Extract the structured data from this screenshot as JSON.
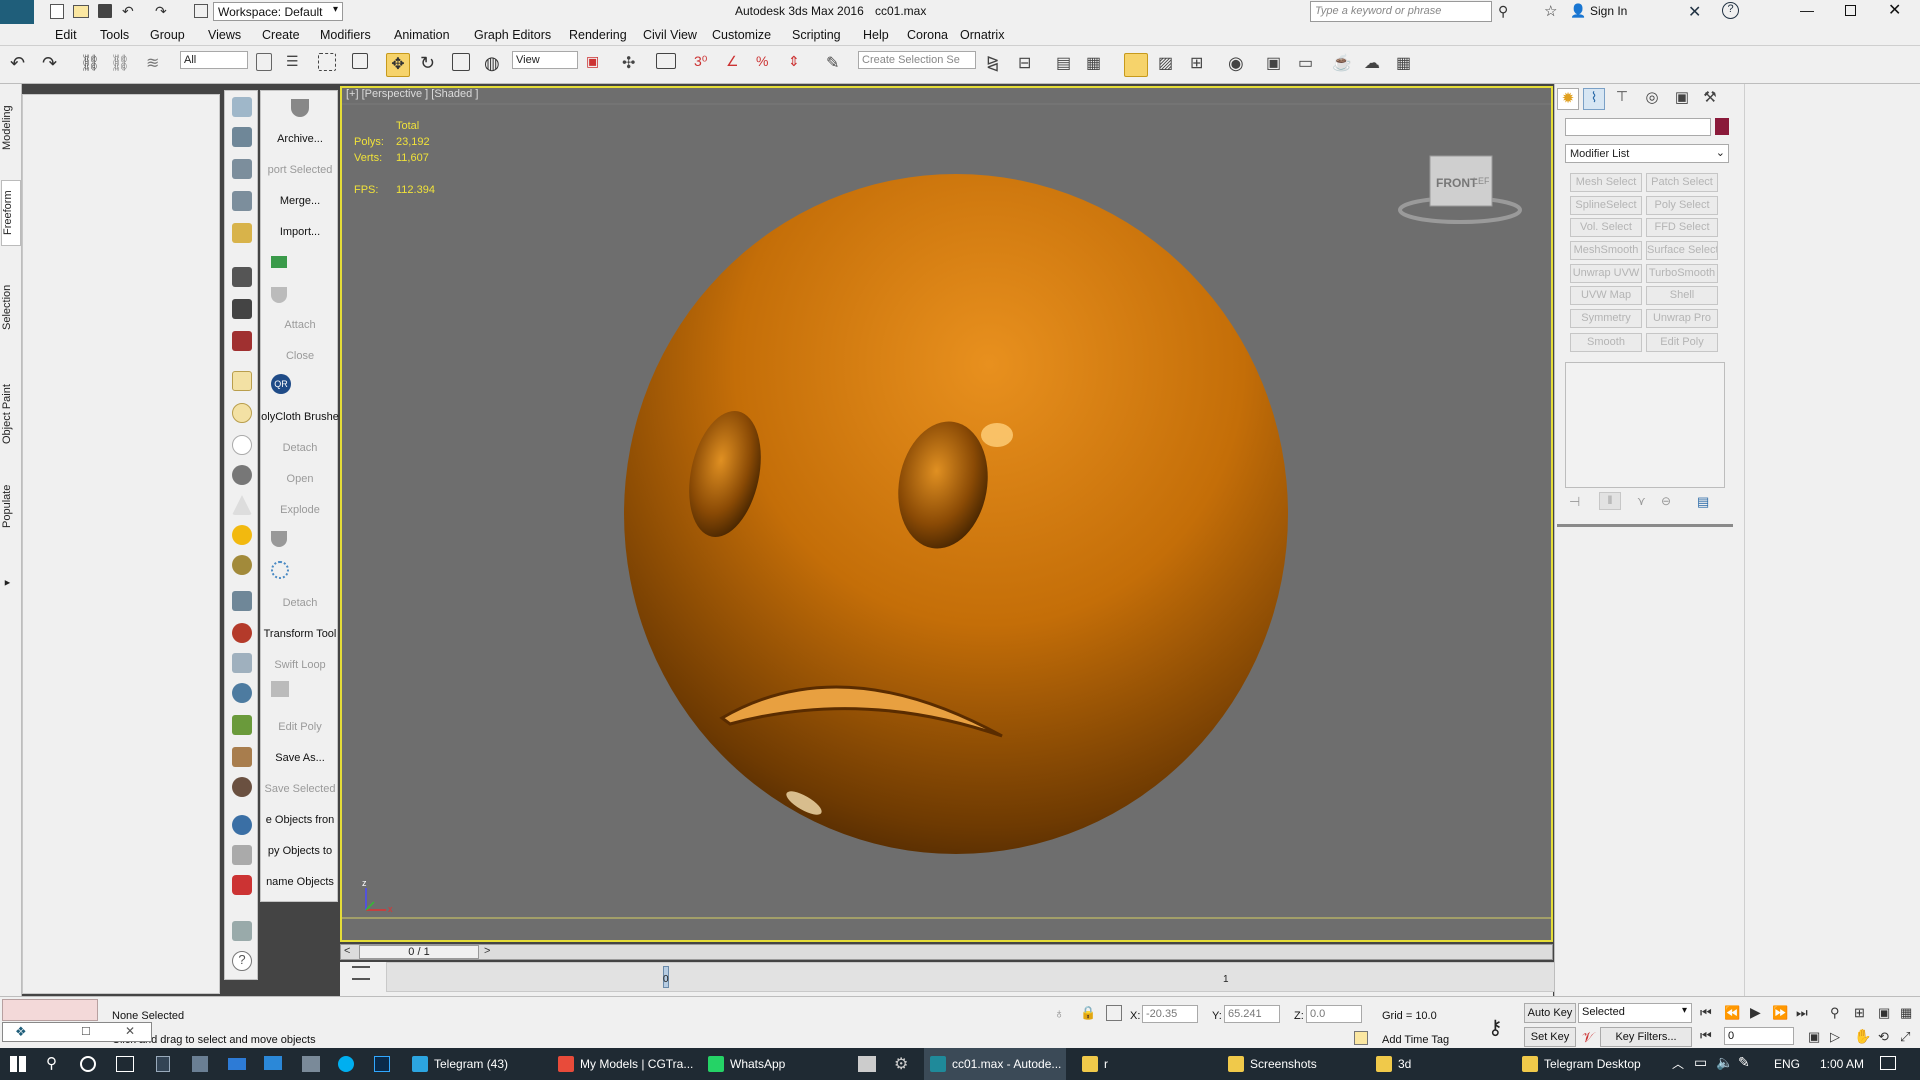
{
  "titlebar": {
    "workspace": "Workspace: Default",
    "app_title": "Autodesk 3ds Max 2016",
    "file": "cc01.max",
    "search_placeholder": "Type a keyword or phrase",
    "signin": "Sign In",
    "logo": "MAX"
  },
  "menu": [
    "Edit",
    "Tools",
    "Group",
    "Views",
    "Create",
    "Modifiers",
    "Animation",
    "Graph Editors",
    "Rendering",
    "Civil View",
    "Customize",
    "Scripting",
    "Help",
    "Corona",
    "Ornatrix"
  ],
  "toolbar": {
    "filter": "All",
    "coord": "View",
    "selection_set": "Create Selection Se"
  },
  "left_tabs": [
    "Modeling",
    "Freeform",
    "Selection",
    "Object Paint",
    "Populate"
  ],
  "tool_labels": [
    {
      "t": "Archive...",
      "d": false
    },
    {
      "t": "port Selected",
      "d": true
    },
    {
      "t": "Merge...",
      "d": false
    },
    {
      "t": "Import...",
      "d": false
    },
    {
      "t": "Attach",
      "d": true
    },
    {
      "t": "Close",
      "d": true
    },
    {
      "t": "olyCloth Brushe",
      "d": false
    },
    {
      "t": "Detach",
      "d": true
    },
    {
      "t": "Open",
      "d": true
    },
    {
      "t": "Explode",
      "d": true
    },
    {
      "t": "Detach",
      "d": true
    },
    {
      "t": "Transform Tool",
      "d": false
    },
    {
      "t": "Swift Loop",
      "d": true
    },
    {
      "t": "Edit Poly",
      "d": true
    },
    {
      "t": "Save As...",
      "d": false
    },
    {
      "t": "Save Selected",
      "d": true
    },
    {
      "t": "e Objects fron",
      "d": false
    },
    {
      "t": "py Objects to",
      "d": false
    },
    {
      "t": "name Objects",
      "d": false
    }
  ],
  "viewport": {
    "header": "[+] [Perspective ] [Shaded ]",
    "total": "Total",
    "polys_label": "Polys:",
    "polys": "23,192",
    "verts_label": "Verts:",
    "verts": "11,607",
    "fps_label": "FPS:",
    "fps": "112.394",
    "viewcube_front": "FRONT",
    "viewcube_side": "LEFT"
  },
  "timeline": {
    "frame": "0 / 1",
    "tick0": "0",
    "tick1": "1"
  },
  "command_panel": {
    "modifier_list": "Modifier List",
    "buttons": [
      "Mesh Select",
      "Patch Select",
      "SplineSelect",
      "Poly Select",
      "Vol. Select",
      "FFD Select",
      "MeshSmooth",
      "Surface Select",
      "Unwrap UVW",
      "TurboSmooth",
      "UVW Map",
      "Shell",
      "Symmetry",
      "Unwrap Pro",
      "Smooth",
      "Edit Poly"
    ],
    "object_color": "#8a1a3a"
  },
  "status": {
    "none_selected": "None Selected",
    "prompt": "Click and drag to select and move objects",
    "x_label": "X:",
    "x": "-20.35",
    "y_label": "Y:",
    "y": "65.241",
    "z_label": "Z:",
    "z": "0.0",
    "grid": "Grid = 10.0",
    "add_time_tag": "Add Time Tag",
    "auto_key": "Auto Key",
    "set_key": "Set Key",
    "selected": "Selected",
    "key_filters": "Key Filters...",
    "frame_value": "0"
  },
  "taskbar": {
    "items": [
      "Telegram (43)",
      "My Models | CGTra...",
      "WhatsApp",
      "cc01.max - Autode...",
      "r",
      "Screenshots",
      "3d",
      "Telegram Desktop"
    ],
    "lang": "ENG",
    "time": "1:00 AM"
  }
}
